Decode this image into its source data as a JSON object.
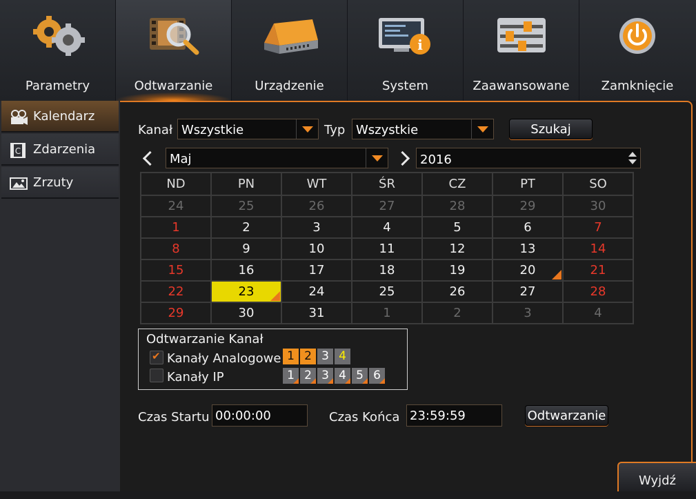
{
  "top_tabs": [
    {
      "label": "Parametry",
      "icon": "gears-icon",
      "active": false
    },
    {
      "label": "Odtwarzanie",
      "icon": "film-magnifier-icon",
      "active": true
    },
    {
      "label": "Urządzenie",
      "icon": "hard-drive-icon",
      "active": false
    },
    {
      "label": "System",
      "icon": "monitor-info-icon",
      "active": false
    },
    {
      "label": "Zaawansowane",
      "icon": "sliders-icon",
      "active": false
    },
    {
      "label": "Zamknięcie",
      "icon": "power-icon",
      "active": false
    }
  ],
  "sidebar": {
    "items": [
      {
        "label": "Kalendarz",
        "icon": "film-reel-icon",
        "active": true
      },
      {
        "label": "Zdarzenia",
        "icon": "event-clip-icon",
        "active": false
      },
      {
        "label": "Zrzuty",
        "icon": "snapshot-image-icon",
        "active": false
      }
    ]
  },
  "filters": {
    "channel_label": "Kanał",
    "channel_value": "Wszystkie",
    "type_label": "Typ",
    "type_value": "Wszystkie",
    "search_button": "Szukaj"
  },
  "month_nav": {
    "month_value": "Maj",
    "year_value": "2016"
  },
  "calendar": {
    "weekdays": [
      "ND",
      "PN",
      "WT",
      "ŚR",
      "CZ",
      "PT",
      "SO"
    ],
    "weeks": [
      [
        {
          "d": "24",
          "t": "other"
        },
        {
          "d": "25",
          "t": "other"
        },
        {
          "d": "26",
          "t": "other"
        },
        {
          "d": "27",
          "t": "other"
        },
        {
          "d": "28",
          "t": "other"
        },
        {
          "d": "29",
          "t": "other"
        },
        {
          "d": "30",
          "t": "other"
        }
      ],
      [
        {
          "d": "1",
          "t": "wk"
        },
        {
          "d": "2",
          "t": "cur"
        },
        {
          "d": "3",
          "t": "cur"
        },
        {
          "d": "4",
          "t": "cur"
        },
        {
          "d": "5",
          "t": "cur"
        },
        {
          "d": "6",
          "t": "cur"
        },
        {
          "d": "7",
          "t": "wk"
        }
      ],
      [
        {
          "d": "8",
          "t": "wk"
        },
        {
          "d": "9",
          "t": "cur"
        },
        {
          "d": "10",
          "t": "cur"
        },
        {
          "d": "11",
          "t": "cur"
        },
        {
          "d": "12",
          "t": "cur"
        },
        {
          "d": "13",
          "t": "cur"
        },
        {
          "d": "14",
          "t": "wk"
        }
      ],
      [
        {
          "d": "15",
          "t": "wk"
        },
        {
          "d": "16",
          "t": "cur"
        },
        {
          "d": "17",
          "t": "cur"
        },
        {
          "d": "18",
          "t": "cur"
        },
        {
          "d": "19",
          "t": "cur"
        },
        {
          "d": "20",
          "t": "cur",
          "rec": true
        },
        {
          "d": "21",
          "t": "wk"
        }
      ],
      [
        {
          "d": "22",
          "t": "wk"
        },
        {
          "d": "23",
          "t": "cur",
          "selected": true,
          "rec": true
        },
        {
          "d": "24",
          "t": "cur"
        },
        {
          "d": "25",
          "t": "cur"
        },
        {
          "d": "26",
          "t": "cur"
        },
        {
          "d": "27",
          "t": "cur"
        },
        {
          "d": "28",
          "t": "wk"
        }
      ],
      [
        {
          "d": "29",
          "t": "wk"
        },
        {
          "d": "30",
          "t": "cur"
        },
        {
          "d": "31",
          "t": "cur"
        },
        {
          "d": "1",
          "t": "other"
        },
        {
          "d": "2",
          "t": "other"
        },
        {
          "d": "3",
          "t": "other"
        },
        {
          "d": "4",
          "t": "other"
        }
      ]
    ]
  },
  "playback_channels": {
    "title": "Odtwarzanie Kanał",
    "analog_label": "Kanały Analogowe",
    "analog_checked": true,
    "analog_channels": [
      {
        "n": "1",
        "on": true,
        "hl": false
      },
      {
        "n": "2",
        "on": true,
        "hl": false
      },
      {
        "n": "3",
        "on": false,
        "hl": false
      },
      {
        "n": "4",
        "on": false,
        "hl": true
      }
    ],
    "ip_label": "Kanały IP",
    "ip_checked": false,
    "ip_channels": [
      "1",
      "2",
      "3",
      "4",
      "5",
      "6"
    ]
  },
  "time": {
    "start_label": "Czas Startu",
    "start_value": "00:00:00",
    "end_label": "Czas Końca",
    "end_value": "23:59:59",
    "play_button": "Odtwarzanie"
  },
  "exit_button": "Wyjdź",
  "colors": {
    "accent": "#e07a24",
    "weekend": "#e8382a",
    "selected_day": "#e8d800"
  }
}
